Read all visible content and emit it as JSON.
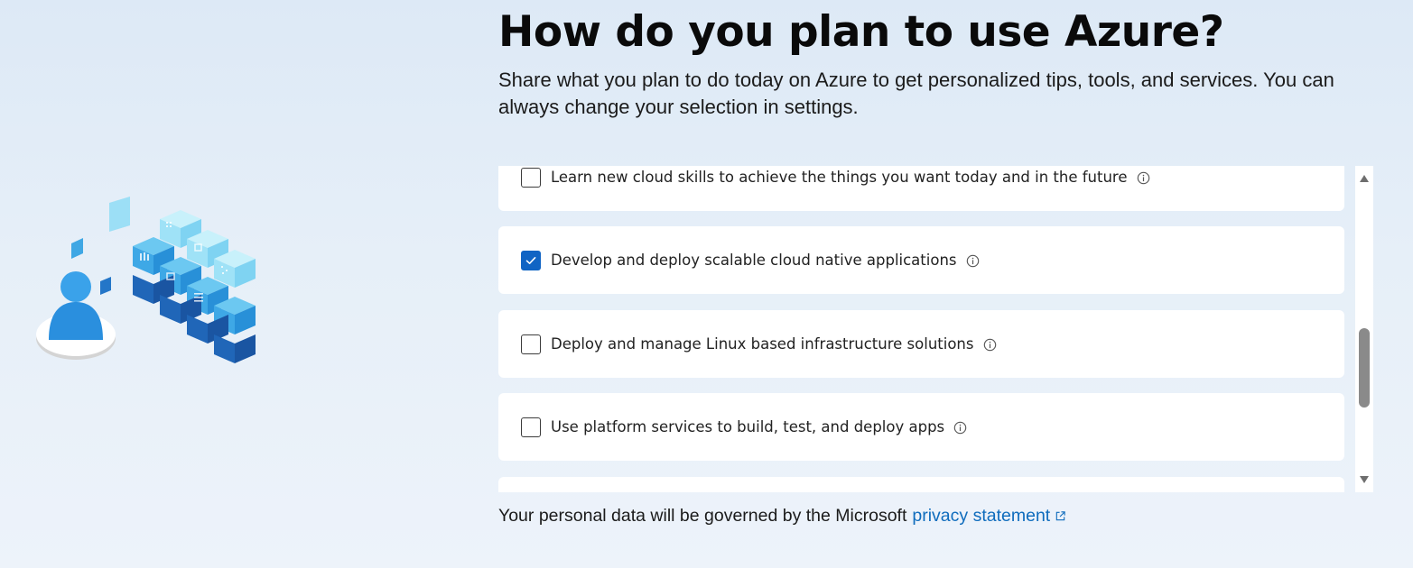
{
  "header": {
    "title": "How do you plan to use Azure?",
    "subtitle": "Share what you plan to do today on Azure to get personalized tips, tools, and services. You can always change your selection in settings."
  },
  "options": [
    {
      "label": "Learn new cloud skills to achieve the things you want today and in the future",
      "checked": false,
      "info_icon": "info-icon"
    },
    {
      "label": "Develop and deploy scalable cloud native applications",
      "checked": true,
      "info_icon": "info-icon"
    },
    {
      "label": "Deploy and manage Linux based infrastructure solutions",
      "checked": false,
      "info_icon": "info-icon"
    },
    {
      "label": "Use platform services to build, test, and deploy apps",
      "checked": false,
      "info_icon": "info-icon"
    }
  ],
  "footer": {
    "text": "Your personal data will be governed by the Microsoft",
    "link_text": "privacy statement",
    "link_icon": "external-link-icon"
  },
  "colors": {
    "accent": "#1064c4",
    "link": "#0f6cbd",
    "card": "#ffffff",
    "background": "#e4eef8"
  }
}
